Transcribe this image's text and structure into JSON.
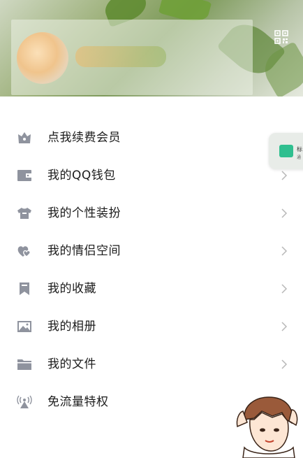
{
  "header": {
    "qr_icon": "qr-code-icon"
  },
  "menu": {
    "items": [
      {
        "label": "点我续费会员",
        "icon": "vip-crown-icon",
        "chevron": false
      },
      {
        "label": "我的QQ钱包",
        "icon": "wallet-icon",
        "chevron": true
      },
      {
        "label": "我的个性装扮",
        "icon": "tshirt-icon",
        "chevron": true
      },
      {
        "label": "我的情侣空间",
        "icon": "couple-hearts-icon",
        "chevron": true
      },
      {
        "label": "我的收藏",
        "icon": "bookmark-icon",
        "chevron": true
      },
      {
        "label": "我的相册",
        "icon": "photo-album-icon",
        "chevron": true
      },
      {
        "label": "我的文件",
        "icon": "folder-icon",
        "chevron": true
      },
      {
        "label": "免流量特权",
        "icon": "signal-tower-icon",
        "chevron": false
      }
    ]
  },
  "float_widget": {
    "line1": "标",
    "line2": "通",
    "icon": "sheet-icon"
  },
  "colors": {
    "icon_gray": "#8f939e",
    "chevron_gray": "#b8b8b8",
    "text": "#1c1c1c"
  }
}
